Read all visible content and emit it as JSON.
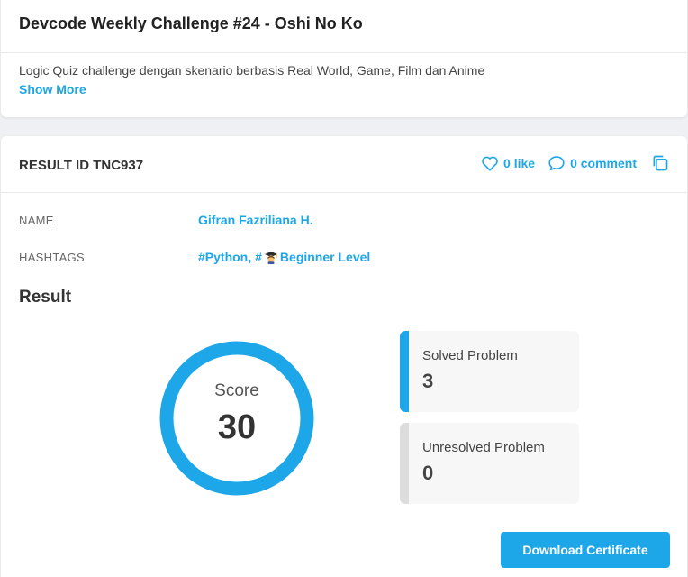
{
  "challenge": {
    "title": "Devcode Weekly Challenge #24 - Oshi No Ko",
    "description": "Logic Quiz challenge dengan skenario berbasis Real World, Game, Film dan Anime",
    "show_more": "Show More"
  },
  "result_card": {
    "result_id": "RESULT ID TNC937",
    "like": "0 like",
    "comment": "0 comment"
  },
  "info": {
    "name_label": "NAME",
    "name_value": "Gifran Fazriliana H.",
    "hashtags_label": "HASHTAGS",
    "hashtag_1": "#Python,",
    "hashtag_2_prefix": "#",
    "hashtag_2_text": "Beginner Level"
  },
  "result": {
    "heading": "Result",
    "score_label": "Score",
    "score_value": "30",
    "solved_label": "Solved Problem",
    "solved_value": "3",
    "unresolved_label": "Unresolved Problem",
    "unresolved_value": "0",
    "download_button": "Download Certificate"
  },
  "icons": {
    "like": "heart-icon",
    "comment": "comment-bubble-icon",
    "copy": "copy-icon",
    "hashtag_badge": "graduate-emoji-icon"
  },
  "colors": {
    "accent": "#1ea7e8",
    "unresolved_bar": "#dcdcdc",
    "background": "#eef0f3"
  }
}
